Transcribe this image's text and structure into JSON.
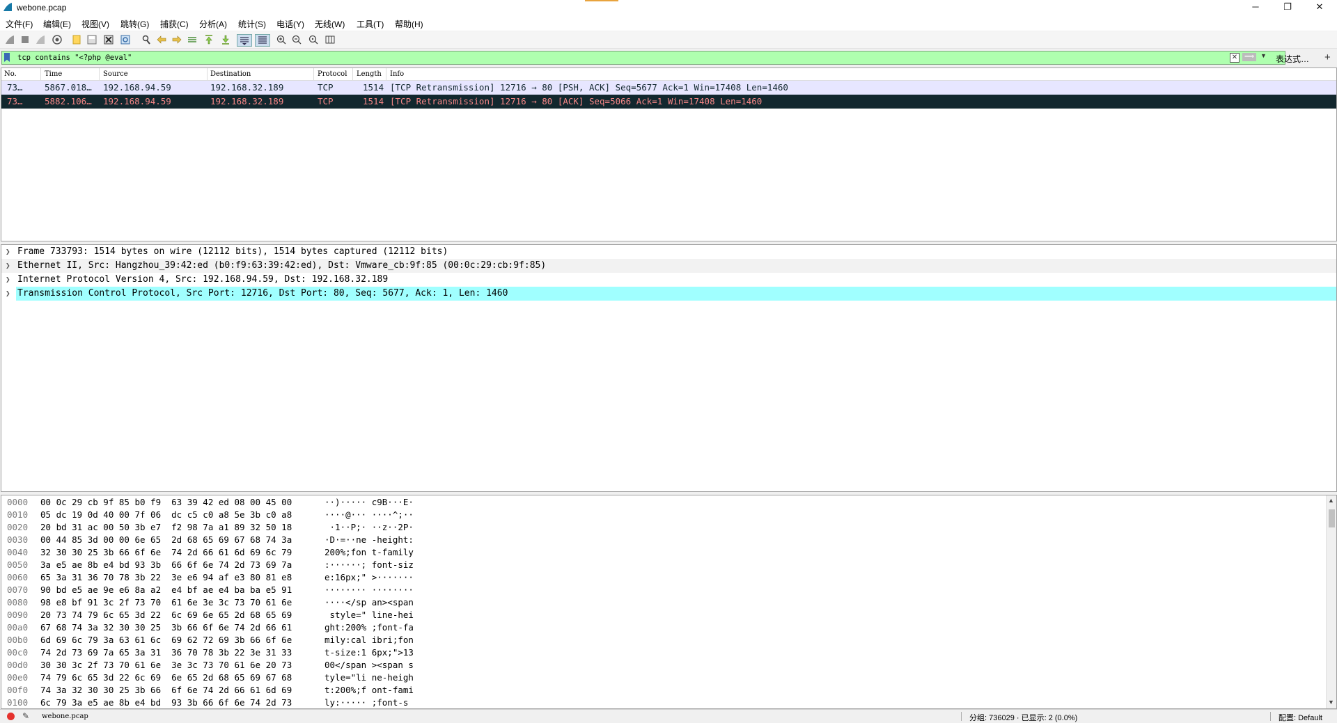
{
  "window": {
    "title": "webone.pcap",
    "minimize": "─",
    "restore": "❐",
    "close": "✕"
  },
  "menu": [
    "文件(F)",
    "编辑(E)",
    "视图(V)",
    "跳转(G)",
    "捕获(C)",
    "分析(A)",
    "统计(S)",
    "电话(Y)",
    "无线(W)",
    "工具(T)",
    "帮助(H)"
  ],
  "toolbar": [
    "start-capture",
    "stop-capture",
    "restart-capture",
    "capture-options",
    "open-file",
    "save-file",
    "close-file",
    "reload-file",
    "find-packet",
    "go-back",
    "go-forward",
    "go-to-packet",
    "go-first",
    "go-last",
    "auto-scroll",
    "colorize",
    "zoom-in",
    "zoom-out",
    "normal-size",
    "resize-columns"
  ],
  "filter": {
    "value": "tcp contains \"<?php @eval\"",
    "expression_label": "表达式…",
    "clear": "✕",
    "apply": "⟹",
    "dropdown": "▼",
    "add": "+"
  },
  "packet_list": {
    "columns": [
      "No.",
      "Time",
      "Source",
      "Destination",
      "Protocol",
      "Length",
      "Info"
    ],
    "rows": [
      {
        "no": "73…",
        "time": "5867.018…",
        "source": "192.168.94.59",
        "destination": "192.168.32.189",
        "protocol": "TCP",
        "length": "1514",
        "info": "[TCP Retransmission] 12716 → 80 [PSH, ACK] Seq=5677 Ack=1 Win=17408 Len=1460"
      },
      {
        "no": "73…",
        "time": "5882.106…",
        "source": "192.168.94.59",
        "destination": "192.168.32.189",
        "protocol": "TCP",
        "length": "1514",
        "info": "[TCP Retransmission] 12716 → 80 [ACK] Seq=5066 Ack=1 Win=17408 Len=1460"
      }
    ]
  },
  "details": [
    "Frame 733793: 1514 bytes on wire (12112 bits), 1514 bytes captured (12112 bits)",
    "Ethernet II, Src: Hangzhou_39:42:ed (b0:f9:63:39:42:ed), Dst: Vmware_cb:9f:85 (00:0c:29:cb:9f:85)",
    "Internet Protocol Version 4, Src: 192.168.94.59, Dst: 192.168.32.189",
    "Transmission Control Protocol, Src Port: 12716, Dst Port: 80, Seq: 5677, Ack: 1, Len: 1460"
  ],
  "bytes": [
    {
      "off": "0000",
      "hex": "00 0c 29 cb 9f 85 b0 f9  63 39 42 ed 08 00 45 00",
      "ascii": "··)····· c9B···E·"
    },
    {
      "off": "0010",
      "hex": "05 dc 19 0d 40 00 7f 06  dc c5 c0 a8 5e 3b c0 a8",
      "ascii": "····@··· ····^;··"
    },
    {
      "off": "0020",
      "hex": "20 bd 31 ac 00 50 3b e7  f2 98 7a a1 89 32 50 18",
      "ascii": " ·1··P;· ··z··2P·"
    },
    {
      "off": "0030",
      "hex": "00 44 85 3d 00 00 6e 65  2d 68 65 69 67 68 74 3a",
      "ascii": "·D·=··ne -height:"
    },
    {
      "off": "0040",
      "hex": "32 30 30 25 3b 66 6f 6e  74 2d 66 61 6d 69 6c 79",
      "ascii": "200%;fon t-family"
    },
    {
      "off": "0050",
      "hex": "3a e5 ae 8b e4 bd 93 3b  66 6f 6e 74 2d 73 69 7a",
      "ascii": ":······; font-siz"
    },
    {
      "off": "0060",
      "hex": "65 3a 31 36 70 78 3b 22  3e e6 94 af e3 80 81 e8",
      "ascii": "e:16px;\" >·······"
    },
    {
      "off": "0070",
      "hex": "90 bd e5 ae 9e e6 8a a2  e4 bf ae e4 ba ba e5 91",
      "ascii": "········ ········"
    },
    {
      "off": "0080",
      "hex": "98 e8 bf 91 3c 2f 73 70  61 6e 3e 3c 73 70 61 6e",
      "ascii": "····</sp an><span"
    },
    {
      "off": "0090",
      "hex": "20 73 74 79 6c 65 3d 22  6c 69 6e 65 2d 68 65 69",
      "ascii": " style=\" line-hei"
    },
    {
      "off": "00a0",
      "hex": "67 68 74 3a 32 30 30 25  3b 66 6f 6e 74 2d 66 61",
      "ascii": "ght:200% ;font-fa"
    },
    {
      "off": "00b0",
      "hex": "6d 69 6c 79 3a 63 61 6c  69 62 72 69 3b 66 6f 6e",
      "ascii": "mily:cal ibri;fon"
    },
    {
      "off": "00c0",
      "hex": "74 2d 73 69 7a 65 3a 31  36 70 78 3b 22 3e 31 33",
      "ascii": "t-size:1 6px;\">13"
    },
    {
      "off": "00d0",
      "hex": "30 30 3c 2f 73 70 61 6e  3e 3c 73 70 61 6e 20 73",
      "ascii": "00</span ><span s"
    },
    {
      "off": "00e0",
      "hex": "74 79 6c 65 3d 22 6c 69  6e 65 2d 68 65 69 67 68",
      "ascii": "tyle=\"li ne-heigh"
    },
    {
      "off": "00f0",
      "hex": "74 3a 32 30 30 25 3b 66  6f 6e 74 2d 66 61 6d 69",
      "ascii": "t:200%;f ont-fami"
    },
    {
      "off": "0100",
      "hex": "6c 79 3a e5 ae 8b e4 bd  93 3b 66 6f 6e 74 2d 73",
      "ascii": "ly:····· ;font-s"
    }
  ],
  "status": {
    "file": "webone.pcap",
    "packets": "分组: 736029 · 已显示: 2 (0.0%)",
    "profile": "配置: Default"
  }
}
